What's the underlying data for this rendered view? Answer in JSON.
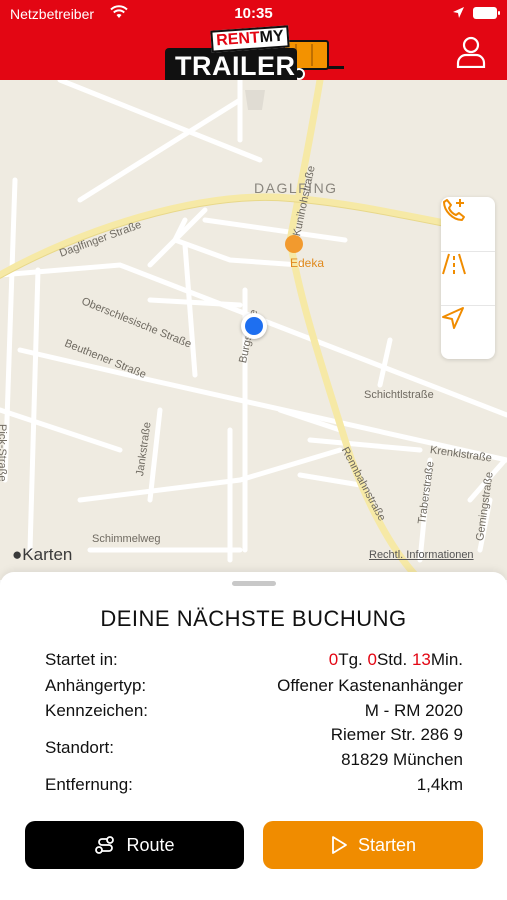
{
  "status_bar": {
    "carrier": "Netzbetreiber",
    "time": "10:35"
  },
  "header": {
    "logo_rent": "RENT",
    "logo_my": "MY",
    "logo_trailer": "TRAILER",
    "brand_color": "#e30613",
    "user_icon": "user-icon"
  },
  "map": {
    "district": "DAGLFING",
    "streets": {
      "kunihohstrasse": "Kunihohstraße",
      "daglfinger": "Daglfinger Straße",
      "oberschlesische": "Oberschlesische Straße",
      "beuthener": "Beuthener Straße",
      "burg": "Burgstraße",
      "schichtl": "Schichtlstraße",
      "krenkl": "Krenklstraße",
      "rennbahn": "Rennbahnstraße",
      "traber": "Traberstraße",
      "gemings": "Gemingstraße",
      "jank": "Jankstraße",
      "schimmel": "Schimmelweg",
      "pick": "Pick-Straße"
    },
    "poi_edeka": "Edeka",
    "karten": "Karten",
    "legal": "Rechtl. Informationen",
    "controls": [
      "call-icon",
      "road-icon",
      "navigation-arrow-icon"
    ],
    "accent_color": "#f08c00"
  },
  "booking": {
    "title": "DEINE NÄCHSTE BUCHUNG",
    "start_label": "Startet in:",
    "start_days": "0",
    "start_days_unit": "Tg.",
    "start_hours": "0",
    "start_hours_unit": "Std.",
    "start_minutes": "13",
    "start_minutes_unit": "Min.",
    "trailer_type_label": "Anhängertyp:",
    "trailer_type_value": "Offener Kastenanhänger",
    "plate_label": "Kennzeichen:",
    "plate_value": "M - RM 2020",
    "location_label": "Standort:",
    "location_line1": "Riemer Str. 286 9",
    "location_line2": "81829 München",
    "distance_label": "Entfernung:",
    "distance_value": "1,4km",
    "route_button": "Route",
    "start_button": "Starten"
  }
}
